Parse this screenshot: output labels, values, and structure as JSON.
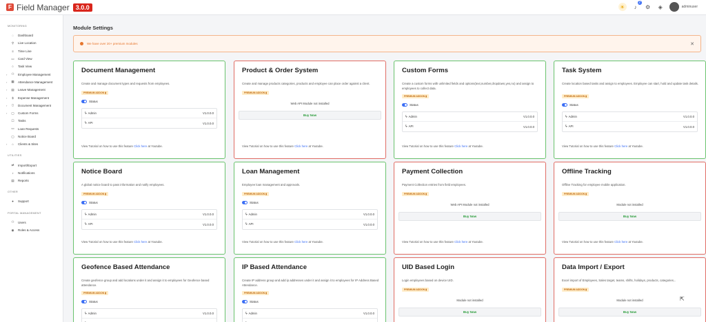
{
  "app": {
    "name": "Field Manager",
    "version": "3.0.0",
    "logo_letter": "F",
    "user": "adminuser",
    "notifications": "2"
  },
  "sidebar": {
    "sections": [
      {
        "title": "MONITORING",
        "items": [
          {
            "label": "Dashboard",
            "icon": "dashboard-icon",
            "glyph": "◌",
            "chev": ""
          },
          {
            "label": "Live Location",
            "icon": "location-icon",
            "glyph": "⚲",
            "chev": ""
          },
          {
            "label": "Time Line",
            "icon": "timeline-icon",
            "glyph": "≡",
            "chev": ""
          },
          {
            "label": "Card View",
            "icon": "card-icon",
            "glyph": "▭",
            "chev": ""
          },
          {
            "label": "Task View",
            "icon": "task-icon",
            "glyph": "○",
            "chev": ""
          },
          {
            "label": "Employee Management",
            "icon": "users-icon",
            "glyph": "⚇",
            "chev": "›"
          },
          {
            "label": "Attendance Management",
            "icon": "calendar-icon",
            "glyph": "▦",
            "chev": "›"
          },
          {
            "label": "Leave Management",
            "icon": "leave-icon",
            "glyph": "▤",
            "chev": "›"
          },
          {
            "label": "Expense Management",
            "icon": "expense-icon",
            "glyph": "$",
            "chev": "›"
          },
          {
            "label": "Document Management",
            "icon": "document-icon",
            "glyph": "▯",
            "chev": "›"
          },
          {
            "label": "Custom Forms",
            "icon": "forms-icon",
            "glyph": "▢",
            "chev": "›"
          },
          {
            "label": "Tasks",
            "icon": "tasks-icon",
            "glyph": "☐",
            "chev": ""
          },
          {
            "label": "Loan Requests",
            "icon": "loan-icon",
            "glyph": "▭",
            "chev": ""
          },
          {
            "label": "Notice Board",
            "icon": "notice-icon",
            "glyph": "▢",
            "chev": ""
          },
          {
            "label": "Clients & Sites",
            "icon": "clients-icon",
            "glyph": "⌂",
            "chev": "›"
          }
        ]
      },
      {
        "title": "UTILITIES",
        "items": [
          {
            "label": "Import/Export",
            "icon": "import-export-icon",
            "glyph": "⇄",
            "chev": ""
          },
          {
            "label": "Notifications",
            "icon": "bell-icon",
            "glyph": "♪",
            "chev": ""
          },
          {
            "label": "Reports",
            "icon": "reports-icon",
            "glyph": "▤",
            "chev": ""
          }
        ]
      },
      {
        "title": "OTHER",
        "items": [
          {
            "label": "Support",
            "icon": "support-icon",
            "glyph": "●",
            "chev": ""
          }
        ]
      },
      {
        "title": "PORTAL MANAGEMENT",
        "items": [
          {
            "label": "Users",
            "icon": "users-icon",
            "glyph": "⚇",
            "chev": ""
          },
          {
            "label": "Roles & Access",
            "icon": "roles-icon",
            "glyph": "◉",
            "chev": ""
          }
        ]
      }
    ]
  },
  "page": {
    "title": "Module Settings",
    "alert": "We have over 20+ premium modules"
  },
  "labels": {
    "premium": "PREMIUM ADDON ▮",
    "status": "Status",
    "admin": "Admin",
    "api": "API",
    "buy": "Buy Now",
    "tut_prefix": "View Tutorial on how to use this feature",
    "click_here": "Click here",
    "tut_suffix": "at Youtube."
  },
  "cards": [
    {
      "title": "Document Management",
      "desc": "Create and manage document types and requests from employees.",
      "state": "installed",
      "admin_version": "V1.0.0.0",
      "api_version": "V1.0.0.0"
    },
    {
      "title": "Product & Order System",
      "desc": "Create and manage products categories, products and employee can place order against a client.",
      "state": "missing",
      "missing_text": "Web API Module not installed"
    },
    {
      "title": "Custom Forms",
      "desc": "Create a custom forms with unlimited fields and options(text,number,dropdown,yes,no) and assign to employees to collect data.",
      "state": "installed",
      "admin_version": "V1.0.0.0",
      "api_version": "V1.0.0.0"
    },
    {
      "title": "Task System",
      "desc": "Create location based tasks and assign to employees. Employee can start, hold and update task details.",
      "state": "installed",
      "admin_version": "V1.0.0.0",
      "api_version": "V1.0.0.0"
    },
    {
      "title": "Notice Board",
      "desc": "A global notice board to pass information and notify employees.",
      "state": "installed",
      "admin_version": "V1.0.0.0",
      "api_version": "V1.0.0.0"
    },
    {
      "title": "Loan Management",
      "desc": "Employee loan management and approvals.",
      "state": "installed",
      "admin_version": "V1.0.0.0",
      "api_version": "V1.0.0.0"
    },
    {
      "title": "Payment Collection",
      "desc": "Payment Collection entries from field employees.",
      "state": "missing",
      "missing_text": "Web API Module not installed"
    },
    {
      "title": "Offline Tracking",
      "desc": "Offline Tracking for employee mobile application.",
      "state": "missing",
      "missing_text": "Module not installed"
    },
    {
      "title": "Geofence Based Attendance",
      "desc": "Create geofence group and add locations under it and assign it to employees for Geofence based attendance.",
      "state": "installed",
      "admin_version": "V1.0.0.0",
      "api_version": ""
    },
    {
      "title": "IP Based Attendance",
      "desc": "Create IP address group and add ip addresses under it and assign it to employees for IP Address Based Attendance.",
      "state": "installed",
      "admin_version": "V1.0.0.0",
      "api_version": ""
    },
    {
      "title": "UID Based Login",
      "desc": "Login employees based on device UID.",
      "state": "missing",
      "missing_text": "Module not installed"
    },
    {
      "title": "Data Import / Export",
      "desc": "Excel import of Employees, Sales target, teams, shifts, holidays, products, categories...",
      "state": "missing",
      "missing_text": "Module not installed"
    }
  ],
  "colors": {
    "installed_border": "#68c26c",
    "missing_border": "#e06b63",
    "accent": "#3b6ef5",
    "brand": "#d9261c"
  }
}
